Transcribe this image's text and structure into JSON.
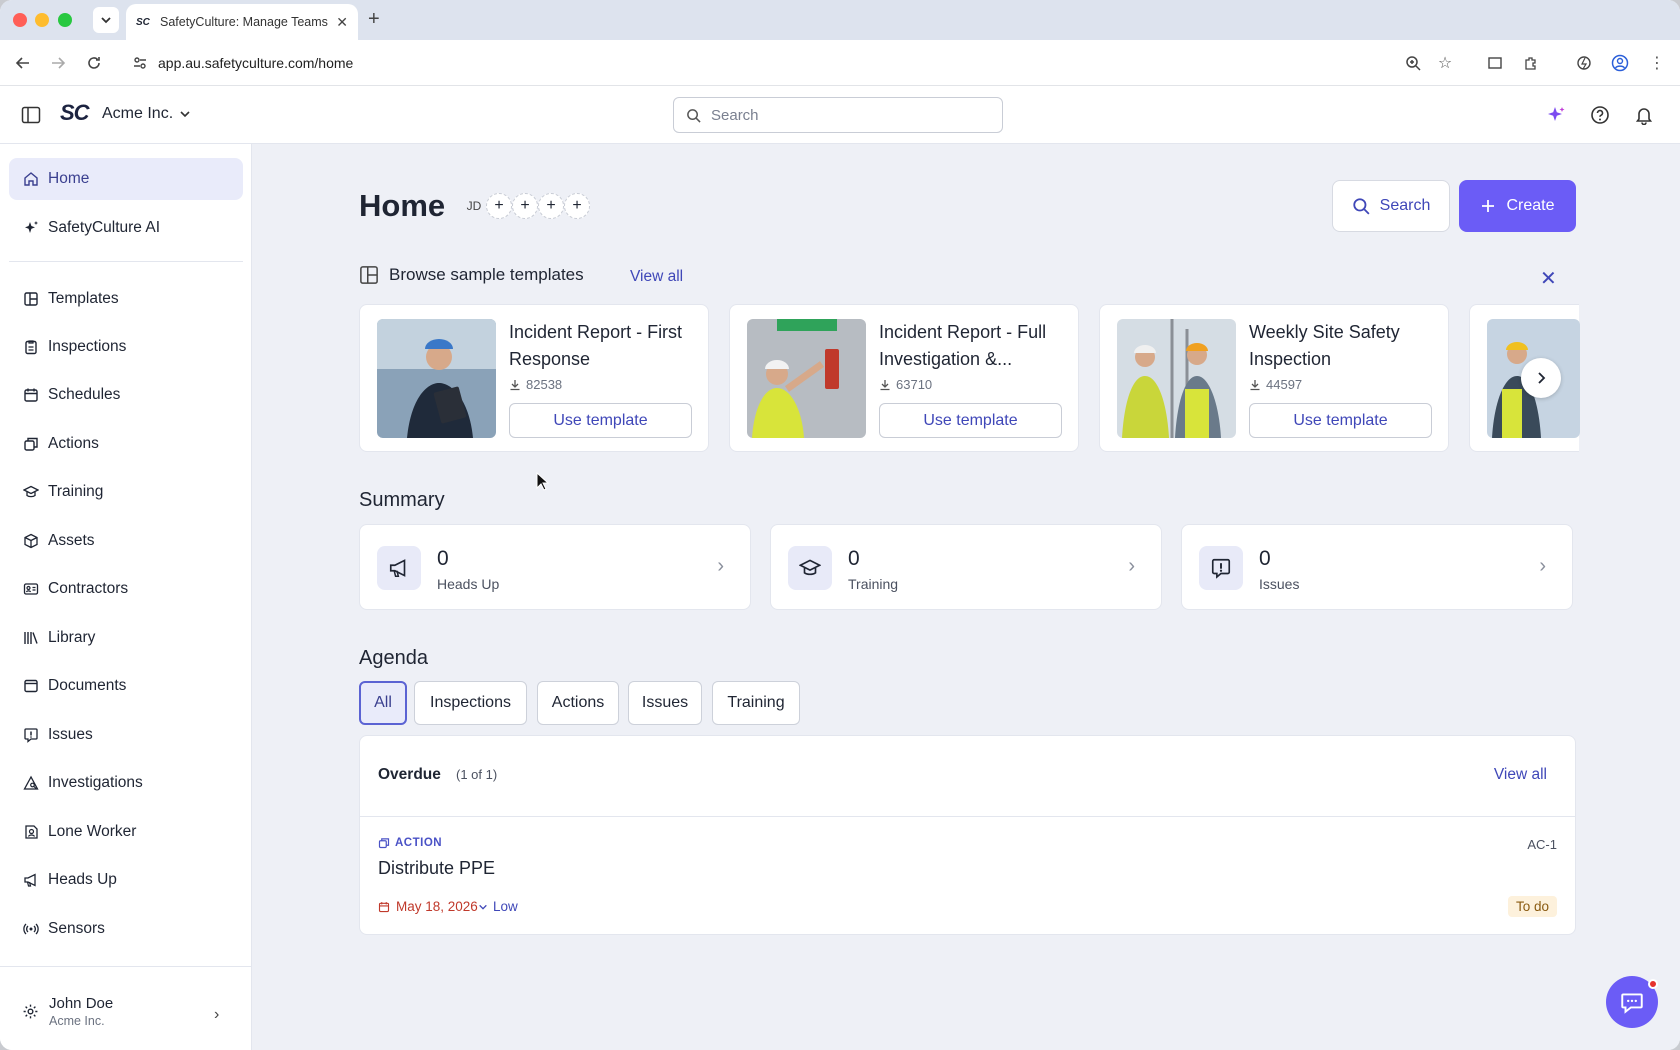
{
  "browser": {
    "tab_title": "SafetyCulture: Manage Teams",
    "favicon_text": "SC",
    "url": "app.au.safetyculture.com/home"
  },
  "header": {
    "logo_text": "SC",
    "org_name": "Acme Inc.",
    "search_placeholder": "Search"
  },
  "sidebar": {
    "top_items": [
      {
        "label": "Home",
        "icon": "home-icon",
        "active": true
      },
      {
        "label": "SafetyCulture AI",
        "icon": "sparkle-icon"
      }
    ],
    "items": [
      {
        "label": "Templates",
        "icon": "template-icon"
      },
      {
        "label": "Inspections",
        "icon": "clipboard-icon"
      },
      {
        "label": "Schedules",
        "icon": "calendar-icon"
      },
      {
        "label": "Actions",
        "icon": "actions-icon"
      },
      {
        "label": "Training",
        "icon": "graduation-cap-icon"
      },
      {
        "label": "Assets",
        "icon": "cube-icon"
      },
      {
        "label": "Contractors",
        "icon": "id-card-icon"
      },
      {
        "label": "Library",
        "icon": "library-icon"
      },
      {
        "label": "Documents",
        "icon": "document-icon"
      },
      {
        "label": "Issues",
        "icon": "alert-bubble-icon"
      },
      {
        "label": "Investigations",
        "icon": "investigation-icon"
      },
      {
        "label": "Lone Worker",
        "icon": "lone-worker-icon"
      },
      {
        "label": "Heads Up",
        "icon": "megaphone-icon"
      },
      {
        "label": "Sensors",
        "icon": "sensor-icon"
      }
    ],
    "user": {
      "name": "John Doe",
      "org": "Acme Inc."
    }
  },
  "main": {
    "title": "Home",
    "avatar_initials": "JD",
    "search_button": "Search",
    "create_button": "Create",
    "browse_title": "Browse sample templates",
    "browse_view_all": "View all",
    "templates": [
      {
        "name": "Incident Report - First Response",
        "downloads": "82538",
        "button": "Use template"
      },
      {
        "name": "Incident Report - Full Investigation &...",
        "downloads": "63710",
        "button": "Use template"
      },
      {
        "name": "Weekly Site Safety Inspection",
        "downloads": "44597",
        "button": "Use template"
      }
    ],
    "summary_title": "Summary",
    "summary": [
      {
        "count": "0",
        "label": "Heads Up",
        "icon": "megaphone-icon"
      },
      {
        "count": "0",
        "label": "Training",
        "icon": "graduation-cap-icon"
      },
      {
        "count": "0",
        "label": "Issues",
        "icon": "alert-bubble-icon"
      }
    ],
    "agenda_title": "Agenda",
    "agenda_tabs": [
      "All",
      "Inspections",
      "Actions",
      "Issues",
      "Training"
    ],
    "agenda": {
      "group_label": "Overdue",
      "group_count": "(1 of 1)",
      "view_all": "View all",
      "item": {
        "type": "ACTION",
        "id": "AC-1",
        "title": "Distribute PPE",
        "date": "May 18, 2026",
        "priority": "Low",
        "status": "To do"
      }
    }
  },
  "colors": {
    "accent": "#6b5cf6",
    "link": "#3f47b8",
    "overdue_date": "#c0392b"
  }
}
